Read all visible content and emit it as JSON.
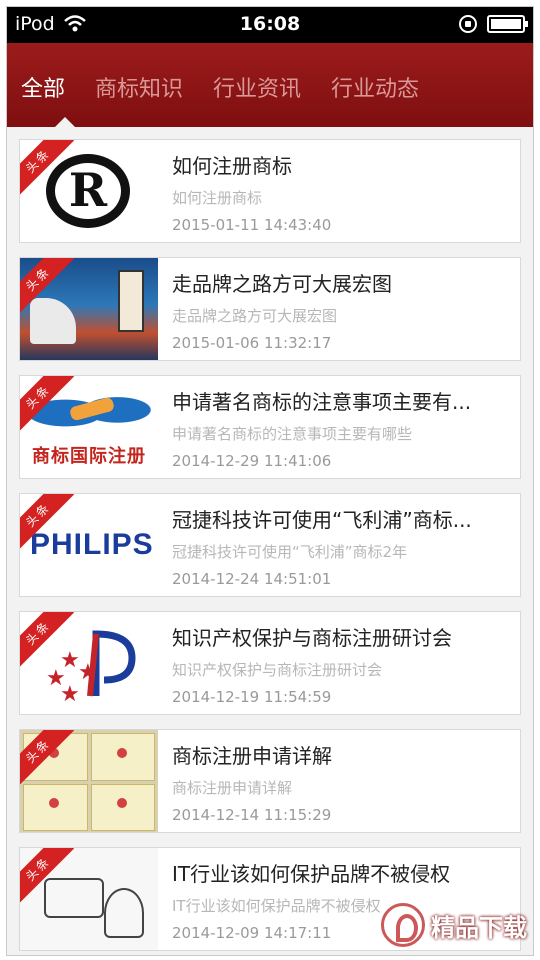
{
  "status_bar": {
    "carrier": "iPod",
    "time": "16:08",
    "battery_level": 1.0
  },
  "tabs": [
    {
      "label": "全部",
      "active": true
    },
    {
      "label": "商标知识",
      "active": false
    },
    {
      "label": "行业资讯",
      "active": false
    },
    {
      "label": "行业动态",
      "active": false
    }
  ],
  "ribbon_label": "头条",
  "articles": [
    {
      "title": "如何注册商标",
      "summary": "如何注册商标",
      "time": "2015-01-11 14:43:40",
      "thumb": "registered-trademark-icon"
    },
    {
      "title": "走品牌之路方可大展宏图",
      "summary": "走品牌之路方可大展宏图",
      "time": "2015-01-06 11:32:17",
      "thumb": "brand-road-image"
    },
    {
      "title": "申请著名商标的注意事项主要有...",
      "summary": "申请著名商标的注意事项主要有哪些",
      "time": "2014-12-29 11:41:06",
      "thumb": "world-map-image",
      "thumb_text": "商标国际注册"
    },
    {
      "title": "冠捷科技许可使用“飞利浦”商标...",
      "summary": "冠捷科技许可使用“飞利浦”商标2年",
      "time": "2014-12-24 14:51:01",
      "thumb": "philips-logo",
      "thumb_text": "PHILIPS"
    },
    {
      "title": "知识产权保护与商标注册研讨会",
      "summary": "知识产权保护与商标注册研讨会",
      "time": "2014-12-19 11:54:59",
      "thumb": "ip-office-logo"
    },
    {
      "title": "商标注册申请详解",
      "summary": "商标注册申请详解",
      "time": "2014-12-14 11:15:29",
      "thumb": "certificates-image"
    },
    {
      "title": "IT行业该如何保护品牌不被侵权",
      "summary": "IT行业该如何保护品牌不被侵权",
      "time": "2014-12-09 14:17:11",
      "thumb": "sketch-image"
    }
  ],
  "watermark": {
    "text": "精品下载"
  },
  "colors": {
    "header": "#8b1515",
    "ribbon": "#d42121",
    "tab_inactive": "#d99797"
  }
}
